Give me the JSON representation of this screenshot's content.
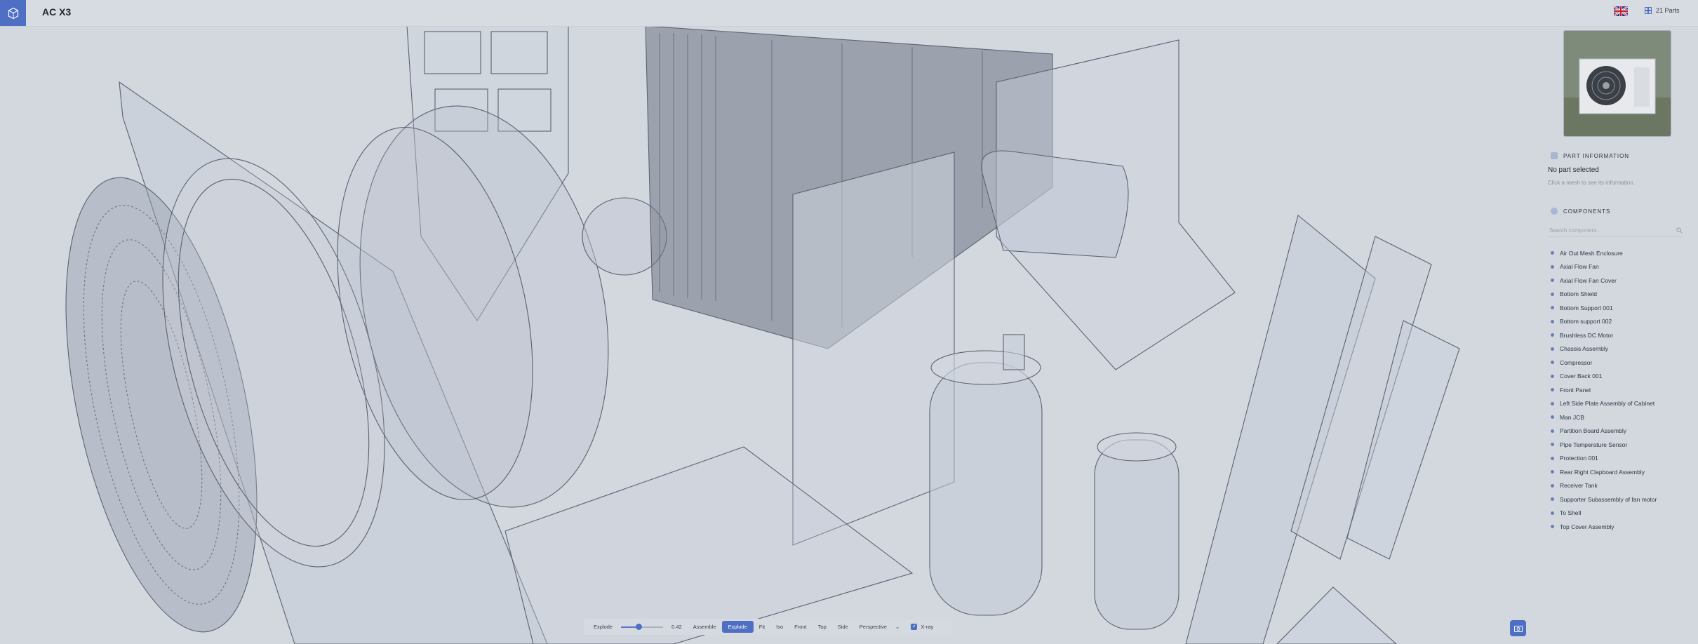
{
  "header": {
    "title": "AC X3",
    "parts_count": "21 Parts",
    "language_flag": "uk-flag-icon"
  },
  "panel": {
    "part_info": {
      "heading": "PART INFORMATION",
      "status": "No part selected",
      "hint": "Click a mesh to see its information."
    },
    "components": {
      "heading": "COMPONENTS",
      "search_placeholder": "Search component...",
      "items": [
        "Air Out Mesh Enclosure",
        "Axial Flow Fan",
        "Axial Flow Fan Cover",
        "Bottom Shield",
        "Bottom Support 001",
        "Bottom support 002",
        "Brushless DC Motor",
        "Chassis Assembly",
        "Compressor",
        "Cover Back 001",
        "Front Panel",
        "Left Side Plate Assembly of Cabinet",
        "Man JCB",
        "Partition Board Assembly",
        "Pipe Temperature Sensor",
        "Protection 001",
        "Rear Right Clapboard Assembly",
        "Receiver Tank",
        "Supporter Subassembly of fan motor",
        "To Shell",
        "Top Cover Assembly"
      ]
    }
  },
  "toolbar": {
    "explode_label": "Explode",
    "explode_value": "0.42",
    "explode_fraction": 0.42,
    "assemble": "Assemble",
    "explode_button": "Explode",
    "fit": "Fit",
    "iso": "Iso",
    "front": "Front",
    "top": "Top",
    "side": "Side",
    "projection": "Perspective",
    "xray": "X-ray"
  },
  "colors": {
    "accent": "#4f6fc4",
    "background": "#d3d8df"
  }
}
